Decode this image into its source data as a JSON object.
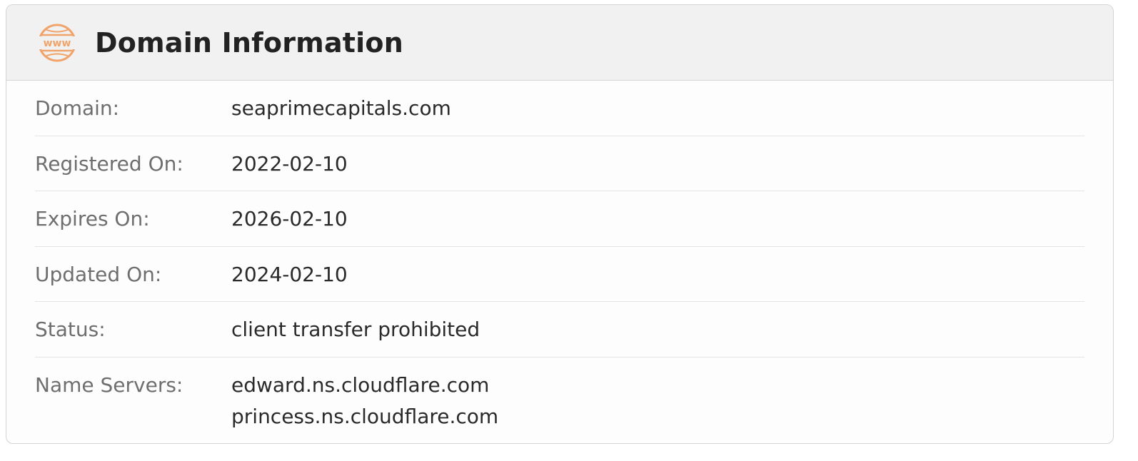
{
  "header": {
    "icon": "www-icon",
    "icon_text": "www",
    "title": "Domain Information",
    "accent_color": "#f0a36b"
  },
  "rows": [
    {
      "label": "Domain:",
      "value": "seaprimecapitals.com"
    },
    {
      "label": "Registered On:",
      "value": "2022-02-10"
    },
    {
      "label": "Expires On:",
      "value": "2026-02-10"
    },
    {
      "label": "Updated On:",
      "value": "2024-02-10"
    },
    {
      "label": "Status:",
      "value": "client transfer prohibited"
    },
    {
      "label": "Name Servers:",
      "values": [
        "edward.ns.cloudflare.com",
        "princess.ns.cloudflare.com"
      ]
    }
  ]
}
